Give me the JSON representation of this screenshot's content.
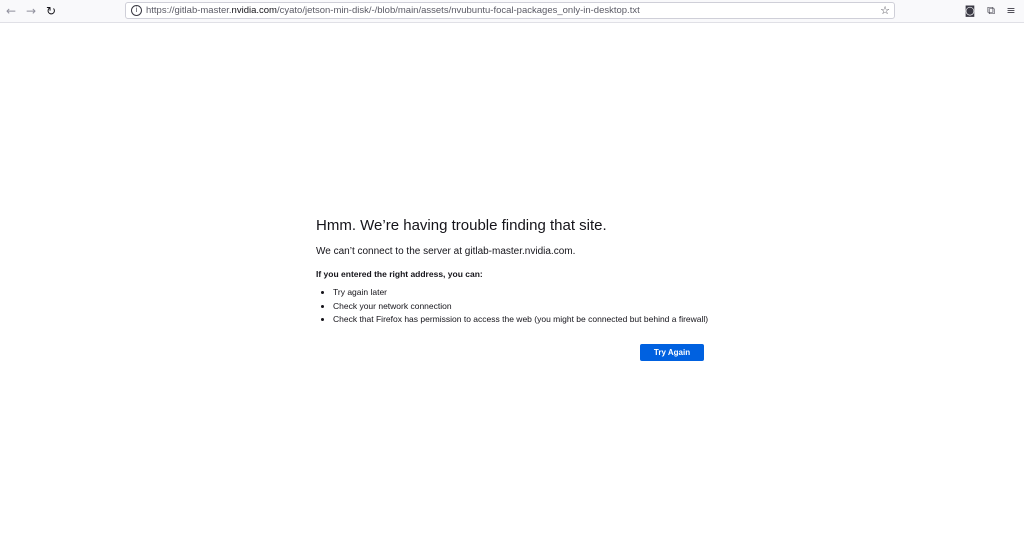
{
  "browser": {
    "url_prefix": "https://gitlab-master.",
    "url_domain": "nvidia.com",
    "url_path": "/cyato/jetson-min-disk/-/blob/main/assets/nvubuntu-focal-packages_only-in-desktop.txt",
    "icons": {
      "back": "back-arrow-icon",
      "forward": "forward-arrow-icon",
      "reload": "reload-icon",
      "site_info": "info-icon",
      "bookmark": "star-icon",
      "pocket": "pocket-icon",
      "extensions": "extensions-icon",
      "menu": "hamburger-menu-icon"
    }
  },
  "error": {
    "title": "Hmm. We’re having trouble finding that site.",
    "description": "We can’t connect to the server at gitlab-master.nvidia.com.",
    "hint": "If you entered the right address, you can:",
    "suggestions": [
      "Try again later",
      "Check your network connection",
      "Check that Firefox has permission to access the web (you might be connected but behind a firewall)"
    ],
    "try_again_label": "Try Again",
    "button_color": "#0061e0"
  }
}
